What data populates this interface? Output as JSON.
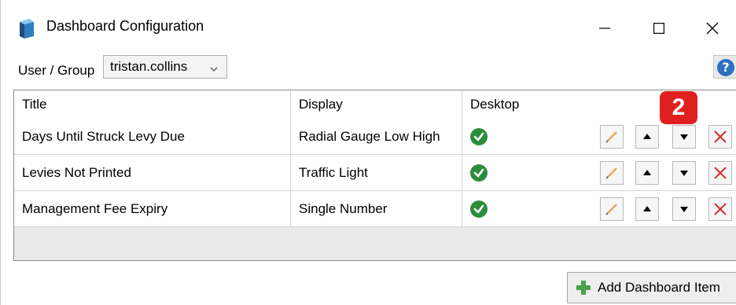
{
  "window": {
    "title": "Dashboard Configuration",
    "icon": "database-icon"
  },
  "user_group": {
    "label": "User / Group",
    "selected": "tristan.collins"
  },
  "help": {
    "label": "?"
  },
  "grid": {
    "columns": [
      "Title",
      "Display",
      "Desktop"
    ],
    "rows": [
      {
        "title": "Days Until Struck Levy Due",
        "display": "Radial Gauge Low High",
        "desktop": true
      },
      {
        "title": "Levies Not Printed",
        "display": "Traffic Light",
        "desktop": true
      },
      {
        "title": "Management Fee Expiry",
        "display": "Single Number",
        "desktop": true
      }
    ]
  },
  "badge": {
    "text": "2",
    "color": "#e02020"
  },
  "add_button": {
    "label": "Add Dashboard Item"
  },
  "colors": {
    "check": "#2c8c3c",
    "delete": "#d03030",
    "add_plus": "#4aa24a"
  }
}
